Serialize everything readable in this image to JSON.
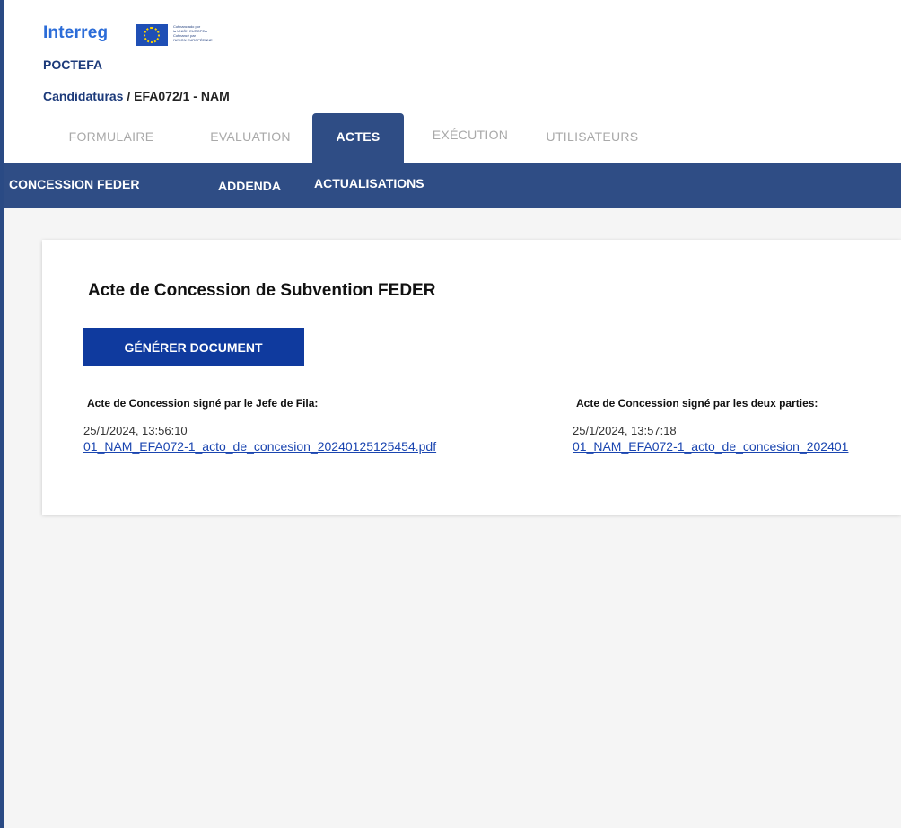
{
  "logo": {
    "name": "Interreg",
    "program": "POCTEFA",
    "eu_text": [
      "Cofinanciado por",
      "la UNIÓN EUROPEA",
      "Cofinancé par",
      "l'UNION EUROPÉENNE"
    ]
  },
  "breadcrumb": {
    "link": "Candidaturas",
    "separator": "/",
    "current": "EFA072/1 - NAM"
  },
  "tabs": [
    "FORMULAIRE",
    "EVALUATION",
    "ACTES",
    "EXÉCUTION",
    "UTILISATEURS"
  ],
  "active_tab": "ACTES",
  "subnav": [
    "CONCESSION FEDER",
    "ADDENDA",
    "ACTUALISATIONS"
  ],
  "card": {
    "title": "Acte de Concession de Subvention FEDER",
    "generate_button": "GÉNÉRER DOCUMENT",
    "documents": [
      {
        "label": "Acte de Concession signé par le Jefe de Fila:",
        "timestamp": "25/1/2024, 13:56:10",
        "file": "01_NAM_EFA072-1_acto_de_concesion_20240125125454.pdf"
      },
      {
        "label": "Acte de Concession signé par les deux parties:",
        "timestamp": "25/1/2024, 13:57:18",
        "file": "01_NAM_EFA072-1_acto_de_concesion_202401"
      }
    ]
  },
  "colors": {
    "brand_blue": "#2f4d85",
    "button_blue": "#0f3a9e",
    "link_blue": "#1a45b0",
    "inactive_tab": "#a9a9a9"
  }
}
